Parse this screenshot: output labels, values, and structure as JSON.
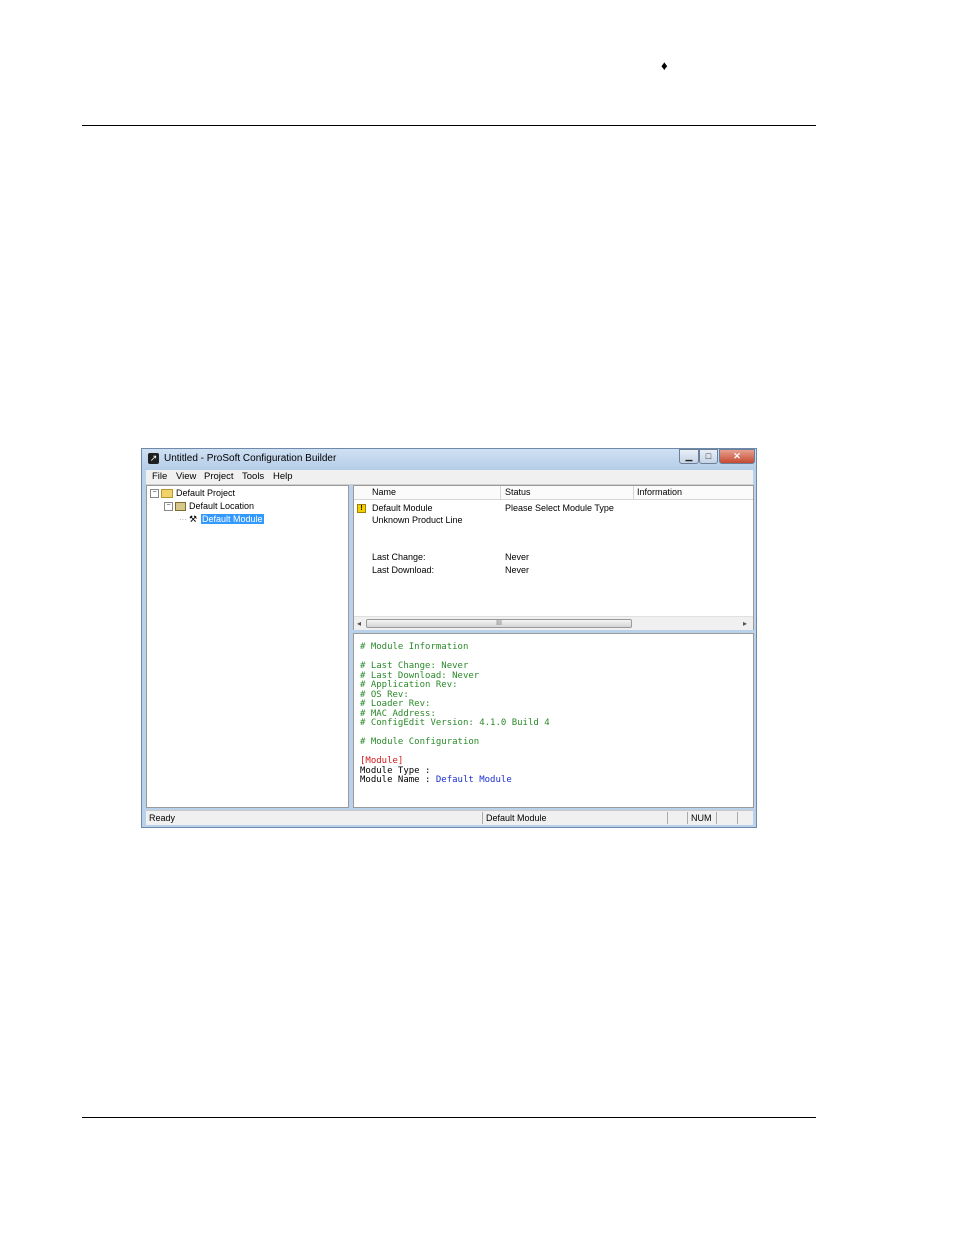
{
  "header": {
    "marker": "♦"
  },
  "window": {
    "title": "Untitled - ProSoft Configuration Builder",
    "menu": [
      "File",
      "View",
      "Project",
      "Tools",
      "Help"
    ],
    "tree": {
      "project": "Default Project",
      "location": "Default Location",
      "module": "Default Module"
    },
    "list": {
      "columns": [
        "Name",
        "Status",
        "Information"
      ],
      "rows": [
        {
          "name": "Default Module",
          "status": "Please Select Module Type"
        },
        {
          "name": "Unknown Product Line",
          "status": ""
        },
        {
          "name": "Last Change:",
          "status": "Never"
        },
        {
          "name": "Last Download:",
          "status": "Never"
        }
      ],
      "scroll_marker": "III"
    },
    "config": {
      "section_info": "# Module Information",
      "info_lines": [
        "# Last Change: Never",
        "# Last Download: Never",
        "# Application Rev:",
        "# OS Rev:",
        "# Loader Rev:",
        "# MAC Address:",
        "# ConfigEdit Version: 4.1.0 Build 4"
      ],
      "section_config": "# Module Configuration",
      "module_tag": "[Module]",
      "module_type_label": "Module Type :",
      "module_name_label": "Module Name :",
      "module_name_value": "Default Module"
    },
    "status": {
      "ready": "Ready",
      "module": "Default Module",
      "num": "NUM"
    }
  }
}
